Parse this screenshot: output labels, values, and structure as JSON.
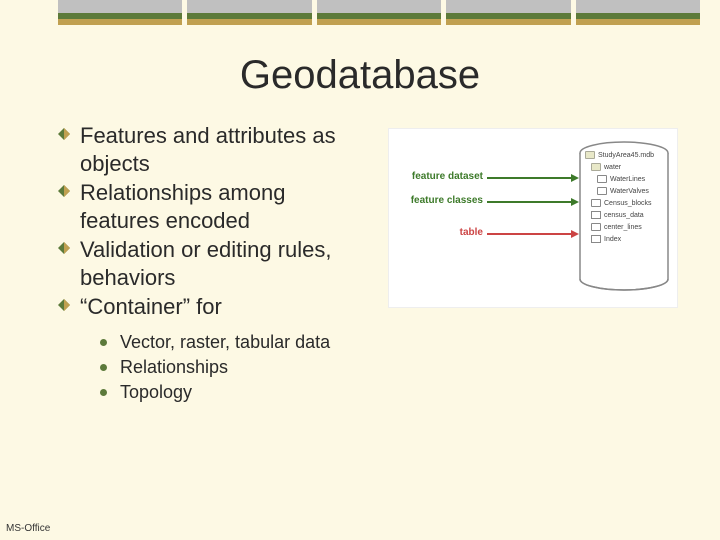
{
  "title": "Geodatabase",
  "bullets": [
    "Features and attributes as objects",
    "Relationships among features encoded",
    "Validation or editing rules, behaviors",
    "“Container” for"
  ],
  "sub_bullets": [
    "Vector, raster, tabular data",
    "Relationships",
    "Topology"
  ],
  "diagram": {
    "label_dataset": "feature dataset",
    "label_classes": "feature classes",
    "label_table": "table",
    "items": {
      "root": "StudyArea45.mdb",
      "child1": "water",
      "child1a": "WaterLines",
      "child1b": "WaterValves",
      "child2": "Census_blocks",
      "child3": "census_data",
      "child4": "center_lines",
      "child5": "Index"
    }
  },
  "footer": "MS-Office"
}
